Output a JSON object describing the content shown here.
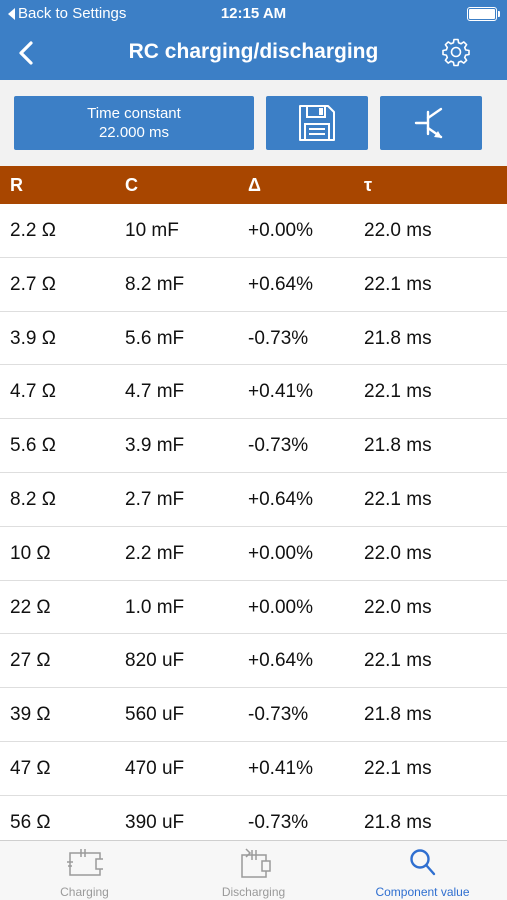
{
  "status_bar": {
    "back_label": "Back to Settings",
    "time": "12:15 AM"
  },
  "nav": {
    "title": "RC charging/discharging"
  },
  "toolbar": {
    "time_constant_label": "Time constant",
    "time_constant_value": "22.000 ms"
  },
  "table": {
    "headers": [
      "R",
      "C",
      "Δ",
      "τ"
    ],
    "rows": [
      [
        "2.2 Ω",
        "10 mF",
        "+0.00%",
        "22.0 ms"
      ],
      [
        "2.7 Ω",
        "8.2 mF",
        "+0.64%",
        "22.1 ms"
      ],
      [
        "3.9 Ω",
        "5.6 mF",
        "-0.73%",
        "21.8 ms"
      ],
      [
        "4.7 Ω",
        "4.7 mF",
        "+0.41%",
        "22.1 ms"
      ],
      [
        "5.6 Ω",
        "3.9 mF",
        "-0.73%",
        "21.8 ms"
      ],
      [
        "8.2 Ω",
        "2.7 mF",
        "+0.64%",
        "22.1 ms"
      ],
      [
        "10 Ω",
        "2.2 mF",
        "+0.00%",
        "22.0 ms"
      ],
      [
        "22 Ω",
        "1.0 mF",
        "+0.00%",
        "22.0 ms"
      ],
      [
        "27 Ω",
        "820 uF",
        "+0.64%",
        "22.1 ms"
      ],
      [
        "39 Ω",
        "560 uF",
        "-0.73%",
        "21.8 ms"
      ],
      [
        "47 Ω",
        "470 uF",
        "+0.41%",
        "22.1 ms"
      ],
      [
        "56 Ω",
        "390 uF",
        "-0.73%",
        "21.8 ms"
      ]
    ]
  },
  "tabs": [
    {
      "label": "Charging",
      "icon": "charging-circuit-icon",
      "active": false
    },
    {
      "label": "Discharging",
      "icon": "discharging-circuit-icon",
      "active": false
    },
    {
      "label": "Component value",
      "icon": "search-icon",
      "active": true
    }
  ],
  "colors": {
    "primary": "#3c7fc6",
    "header": "#a84600",
    "active_tab": "#2f6fd0"
  }
}
